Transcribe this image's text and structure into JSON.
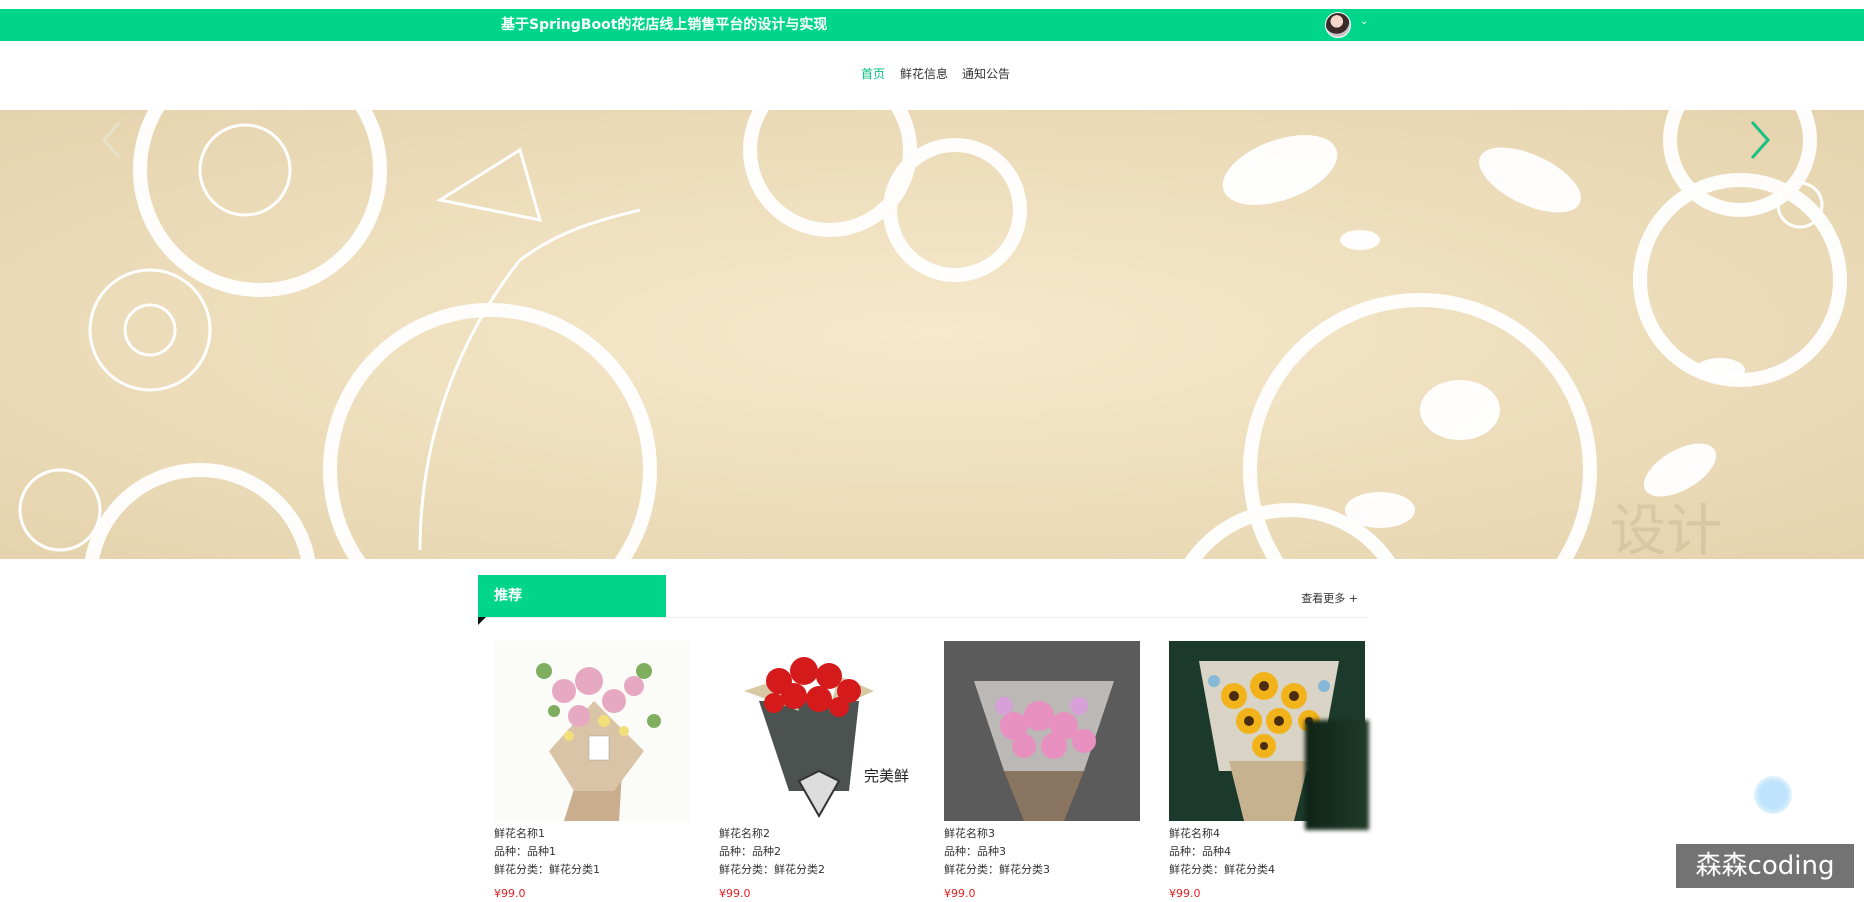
{
  "header": {
    "site_title": "基于SpringBoot的花店线上销售平台的设计与实现",
    "user_menu_caret": "⌄"
  },
  "nav": {
    "items": [
      {
        "label": "首页",
        "active": true
      },
      {
        "label": "鲜花信息",
        "active": false
      },
      {
        "label": "通知公告",
        "active": false
      }
    ]
  },
  "banner": {
    "arrow_prev_icon": "chevron-left-icon",
    "arrow_next_icon": "chevron-right-icon",
    "corner_text": "设计"
  },
  "recommend": {
    "title": "推荐",
    "more_label": "查看更多 +",
    "products": [
      {
        "name": "鲜花名称1",
        "variety": "品种：品种1",
        "category": "鲜花分类：鲜花分类1",
        "price": "¥99.0"
      },
      {
        "name": "鲜花名称2",
        "variety": "品种：品种2",
        "category": "鲜花分类：鲜花分类2",
        "price": "¥99.0",
        "image_text": "完美鲜"
      },
      {
        "name": "鲜花名称3",
        "variety": "品种：品种3",
        "category": "鲜花分类：鲜花分类3",
        "price": "¥99.0"
      },
      {
        "name": "鲜花名称4",
        "variety": "品种：品种4",
        "category": "鲜花分类：鲜花分类4",
        "price": "¥99.0"
      }
    ]
  },
  "watermark": "森森coding",
  "colors": {
    "brand": "#00d68b",
    "active_nav": "#00c27f",
    "price": "#e02020"
  }
}
